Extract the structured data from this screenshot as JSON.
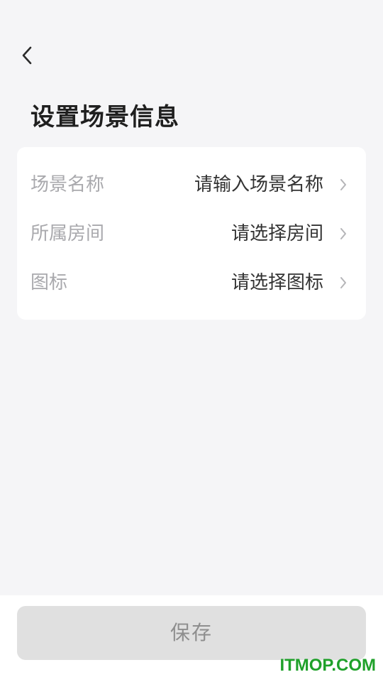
{
  "header": {
    "back_icon": "chevron-left-icon",
    "title": "设置场景信息"
  },
  "form": {
    "rows": [
      {
        "label": "场景名称",
        "value": "请输入场景名称",
        "icon": "chevron-right-icon"
      },
      {
        "label": "所属房间",
        "value": "请选择房间",
        "icon": "chevron-right-icon"
      },
      {
        "label": "图标",
        "value": "请选择图标",
        "icon": "chevron-right-icon"
      }
    ]
  },
  "footer": {
    "save_label": "保存"
  },
  "watermark": "ITMOP.COM",
  "colors": {
    "background": "#f5f5f7",
    "card": "#ffffff",
    "label_text": "#a9a9ad",
    "value_text": "#333333",
    "save_button": "#e0e0e0",
    "watermark": "#1fa12a"
  }
}
